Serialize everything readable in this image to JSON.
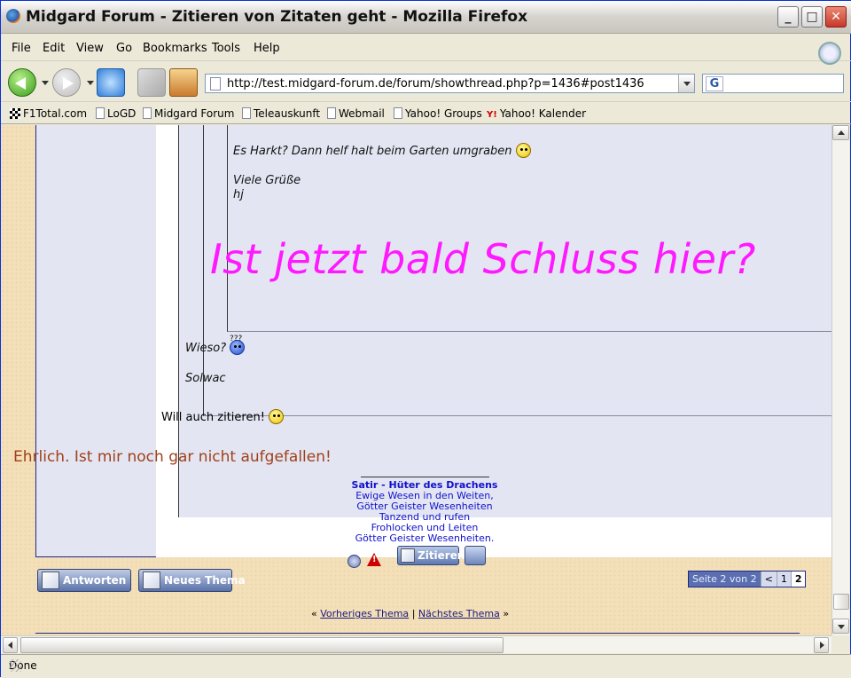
{
  "window": {
    "title": "Midgard Forum - Zitieren von Zitaten geht - Mozilla Firefox",
    "min_label": "_",
    "max_label": "□",
    "close_label": "✕"
  },
  "menu": {
    "file": "File",
    "edit": "Edit",
    "view": "View",
    "go": "Go",
    "bookmarks": "Bookmarks",
    "tools": "Tools",
    "help": "Help"
  },
  "address": {
    "url": "http://test.midgard-forum.de/forum/showthread.php?p=1436#post1436",
    "search_value": ""
  },
  "bookmarks_bar": [
    "F1Total.com",
    "LoGD",
    "Midgard Forum",
    "Teleauskunft",
    "Webmail",
    "Yahoo! Groups",
    "Yahoo! Kalender"
  ],
  "post": {
    "quote_line_1": "Es Harkt? Dann helf halt beim Garten umgraben",
    "quote_greeting": "Viele Grüße",
    "quote_author": "hj",
    "big_text": "Ist jetzt bald Schluss hier?",
    "wieso": "Wieso?",
    "wieso_smiley_label": "???",
    "author_solwac": "Solwac",
    "will_zitieren": "Will auch zitieren!",
    "ehrlich": "Ehrlich. Ist mir noch gar nicht aufgefallen!"
  },
  "signature": {
    "title": "Satir - Hüter des Drachens",
    "lines": [
      "Ewige Wesen in den Weiten,",
      "Götter Geister Wesenheiten",
      "Tanzend und rufen",
      "Frohlocken und Leiten",
      "Götter Geister Wesenheiten."
    ]
  },
  "buttons": {
    "zitieren": "Zitieren",
    "antworten": "Antworten",
    "neues_thema": "Neues Thema"
  },
  "pager": {
    "label": "Seite 2 von 2",
    "prev": "<",
    "page1": "1",
    "page2": "2"
  },
  "thread_nav": {
    "left_marker": "«",
    "prev": "Vorheriges Thema",
    "separator": "|",
    "next": "Nächstes Thema",
    "right_marker": "»"
  },
  "status_bar": {
    "text": "Done"
  },
  "colors": {
    "highlight_text": "#ff19ff",
    "ehrlich_text": "#a0401a",
    "signature_text": "#1010cc",
    "forum_border": "#1f2a8a"
  }
}
